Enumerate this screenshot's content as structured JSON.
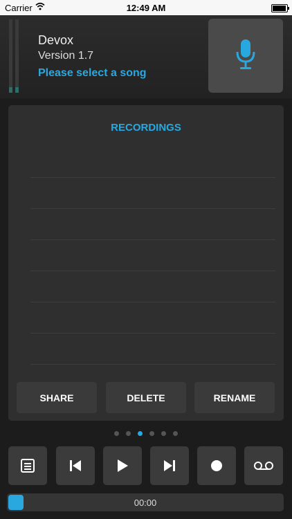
{
  "status_bar": {
    "carrier": "Carrier",
    "time": "12:49 AM"
  },
  "header": {
    "app_name": "Devox",
    "version": "Version 1.7",
    "song_status": "Please select a song",
    "mic_icon": "microphone-icon"
  },
  "recordings": {
    "title": "RECORDINGS",
    "rows": [
      "",
      "",
      "",
      "",
      "",
      "",
      ""
    ],
    "buttons": {
      "share": "SHARE",
      "delete": "DELETE",
      "rename": "RENAME"
    }
  },
  "pager": {
    "total": 6,
    "active_index": 2
  },
  "transport": {
    "icons": [
      "lyrics-icon",
      "skip-back-icon",
      "play-icon",
      "skip-forward-icon",
      "record-icon",
      "voicemail-icon"
    ]
  },
  "progress": {
    "time": "00:00",
    "position": 0
  },
  "colors": {
    "accent": "#29a8e0",
    "background": "#1c1c1c",
    "button": "#3b3b3b"
  }
}
